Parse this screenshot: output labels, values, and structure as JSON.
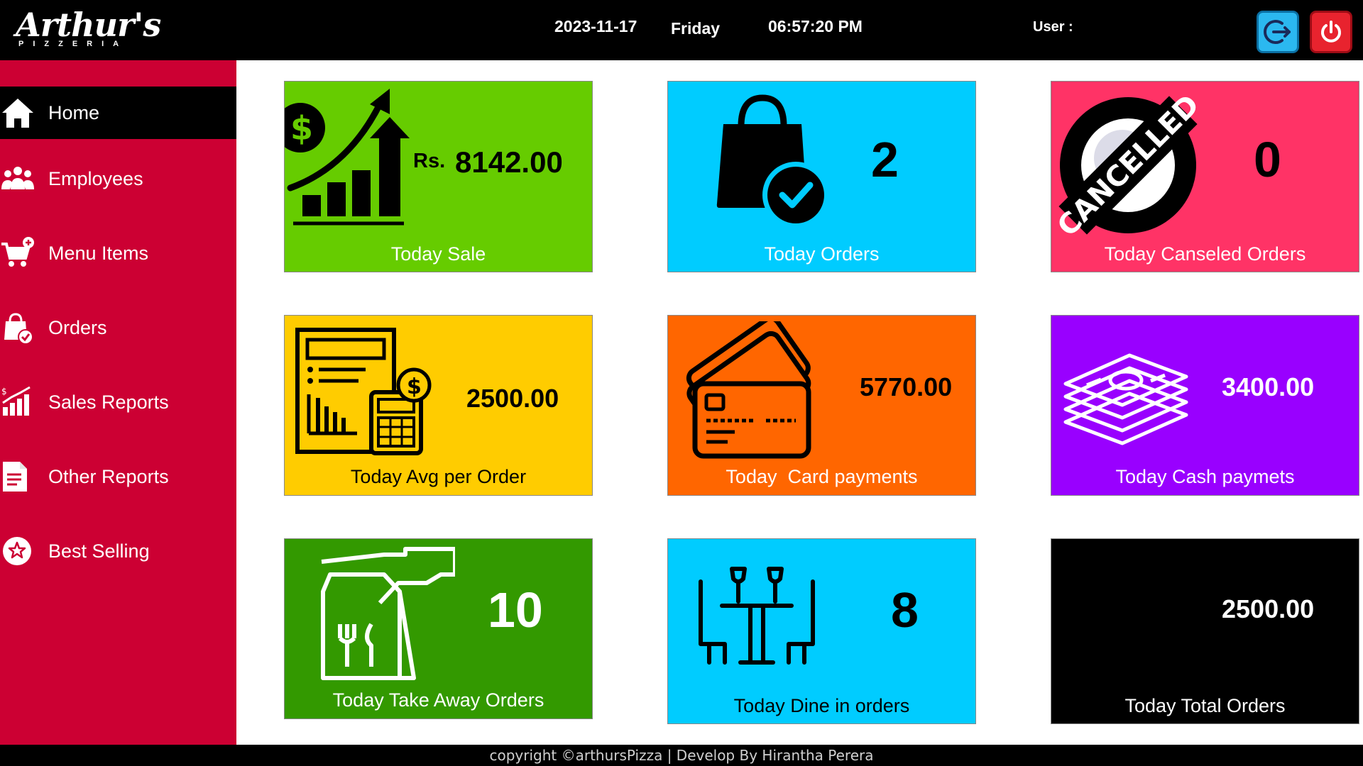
{
  "header": {
    "logo_main": "Arthur's",
    "logo_sub": "PIZZERIA",
    "date": "2023-11-17",
    "day": "Friday",
    "time": "06:57:20 PM",
    "user_label": "User :"
  },
  "sidebar": {
    "items": [
      {
        "label": "Home",
        "icon": "home-icon"
      },
      {
        "label": "Employees",
        "icon": "employees-icon"
      },
      {
        "label": "Menu Items",
        "icon": "cart-icon"
      },
      {
        "label": "Orders",
        "icon": "shopping-bag-icon"
      },
      {
        "label": "Sales Reports",
        "icon": "chart-icon"
      },
      {
        "label": "Other Reports",
        "icon": "document-icon"
      },
      {
        "label": "Best Selling",
        "icon": "star-badge-icon"
      }
    ]
  },
  "tiles": {
    "today_sale": {
      "prefix": "Rs.",
      "value": "8142.00",
      "caption": "Today Sale",
      "color": "#66cc00"
    },
    "today_orders": {
      "value": "2",
      "caption": "Today Orders",
      "color": "#00ccff"
    },
    "today_canceled": {
      "value": "0",
      "caption": "Today Canseled Orders",
      "color": "#ff3366",
      "stamp_text": "CANCELLED"
    },
    "avg_per_order": {
      "value": "2500.00",
      "caption": "Today Avg per Order",
      "color": "#ffcc00"
    },
    "card_payments": {
      "value": "5770.00",
      "caption": "Today  Card payments",
      "color": "#ff6600"
    },
    "cash_payments": {
      "value": "3400.00",
      "caption": "Today Cash paymets",
      "color": "#9900ff"
    },
    "take_away": {
      "value": "10",
      "caption": "Today Take Away Orders",
      "color": "#339900"
    },
    "dine_in": {
      "value": "8",
      "caption": "Today Dine in orders",
      "color": "#00ccff"
    },
    "total_orders": {
      "value": "2500.00",
      "caption": "Today Total Orders",
      "color": "#000000"
    }
  },
  "footer": {
    "text": "copyright ©arthursPizza | Develop By Hirantha Perera"
  }
}
